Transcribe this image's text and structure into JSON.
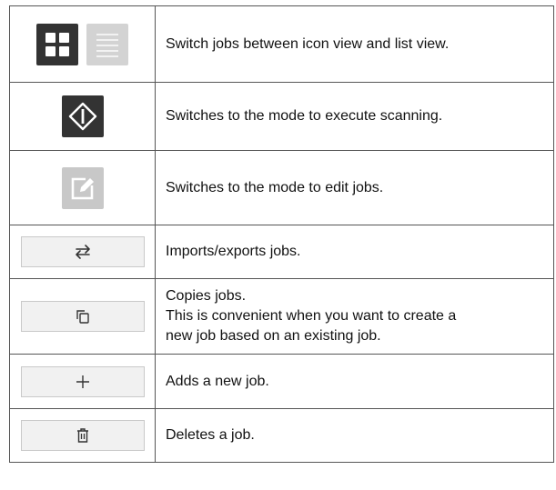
{
  "rows": [
    {
      "icons": [
        "grid-view-icon",
        "list-view-icon"
      ],
      "text": [
        "Switch jobs between icon view and list view."
      ]
    },
    {
      "icons": [
        "scan-mode-icon"
      ],
      "text": [
        "Switches to the mode to execute scanning."
      ]
    },
    {
      "icons": [
        "edit-mode-icon"
      ],
      "text": [
        "Switches to the mode to edit jobs."
      ]
    },
    {
      "icons": [
        "import-export-icon"
      ],
      "text": [
        "Imports/exports jobs."
      ]
    },
    {
      "icons": [
        "copy-icon"
      ],
      "text": [
        "Copies jobs.",
        "This is convenient when you want to create a",
        "new job based on an existing job."
      ]
    },
    {
      "icons": [
        "plus-icon"
      ],
      "text": [
        "Adds a new job."
      ]
    },
    {
      "icons": [
        "trash-icon"
      ],
      "text": [
        "Deletes a job."
      ]
    }
  ],
  "colors": {
    "dark_button": "#333333",
    "light_button": "#d3d3d3",
    "flat_button": "#f1f1f1",
    "border": "#555555"
  }
}
